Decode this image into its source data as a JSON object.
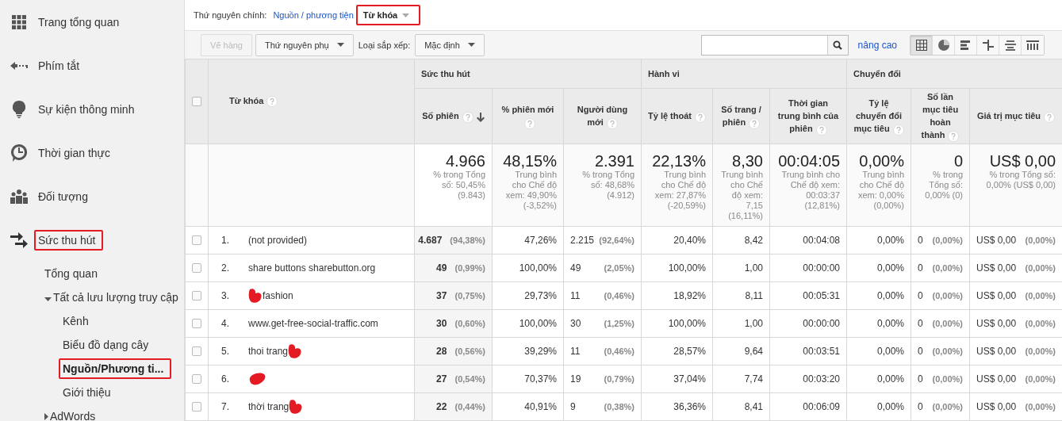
{
  "sidebar": {
    "items": [
      {
        "label": "Trang tổng quan",
        "selected": false
      },
      {
        "label": "Phím tắt",
        "selected": false
      },
      {
        "label": "Sự kiện thông minh",
        "selected": false
      },
      {
        "label": "Thời gian thực",
        "selected": false
      },
      {
        "label": "Đối tượng",
        "selected": false
      },
      {
        "label": "Sức thu hút",
        "selected": false,
        "annotated": true,
        "children": [
          {
            "label": "Tổng quan",
            "selected": false
          },
          {
            "label": "Tất cả lưu lượng truy cập",
            "expanded": true,
            "selected": false,
            "children": [
              {
                "label": "Kênh",
                "selected": false
              },
              {
                "label": "Biểu đồ dạng cây",
                "selected": false
              },
              {
                "label": "Nguồn/Phương ti...",
                "selected": true,
                "annotated": true
              },
              {
                "label": "Giới thiệu",
                "selected": false
              }
            ]
          },
          {
            "label": "AdWords",
            "expanded": false,
            "selected": false
          }
        ]
      }
    ]
  },
  "dimension_bar": {
    "label": "Thứ nguyên chính:",
    "options": [
      {
        "label": "Nguồn / phương tiện",
        "selected": false
      },
      {
        "label": "Từ khóa",
        "selected": true,
        "annotated": true
      }
    ]
  },
  "toolbar": {
    "plot_button": {
      "label": "Vẽ hàng",
      "disabled": true
    },
    "secondary_dimension": "Thứ nguyên phụ",
    "sort_label": "Loại sắp xếp:",
    "sort_value": "Mặc định",
    "advanced_link": "nâng cao",
    "views": [
      {
        "selected": true
      },
      {
        "selected": false
      },
      {
        "selected": false
      },
      {
        "selected": false
      },
      {
        "selected": false
      },
      {
        "selected": false
      }
    ]
  },
  "table": {
    "select_all_checked": false,
    "dimension_column": {
      "label": "Từ khóa",
      "help": true
    },
    "groups": [
      {
        "label": "Sức thu hút"
      },
      {
        "label": "Hành vi"
      },
      {
        "label": "Chuyển đổi"
      }
    ],
    "columns": [
      {
        "label": "Số phiên",
        "help": true,
        "sorted": true
      },
      {
        "label": "% phiên mới",
        "help": true,
        "sorted": false
      },
      {
        "label": "Người dùng mới",
        "help": true,
        "sorted": false
      },
      {
        "label": "Tỷ lệ thoát",
        "help": true,
        "sorted": false
      },
      {
        "label": "Số trang / phiên",
        "help": true,
        "sorted": false
      },
      {
        "label": "Thời gian trung bình của phiên",
        "help": true,
        "sorted": false
      },
      {
        "label": "Tỷ lệ chuyển đổi mục tiêu",
        "help": true,
        "sorted": false
      },
      {
        "label": "Số lần mục tiêu hoàn thành",
        "help": true,
        "sorted": false
      },
      {
        "label": "Giá trị mục tiêu",
        "help": true,
        "sorted": false
      }
    ],
    "totals": [
      {
        "value": "4.966",
        "note": "% trong Tổng số: 50,45% (9.843)"
      },
      {
        "value": "48,15%",
        "note": "Trung bình cho Chế độ xem: 49,90% (-3,52%)"
      },
      {
        "value": "2.391",
        "note": "% trong Tổng số: 48,68% (4.912)"
      },
      {
        "value": "22,13%",
        "note": "Trung bình cho Chế độ xem: 27,87% (-20,59%)"
      },
      {
        "value": "8,30",
        "note": "Trung bình cho Chế độ xem: 7,15 (16,11%)"
      },
      {
        "value": "00:04:05",
        "note": "Trung bình cho Chế độ xem: 00:03:37 (12,81%)"
      },
      {
        "value": "0,00%",
        "note": "Trung bình cho Chế độ xem: 0,00% (0,00%)"
      },
      {
        "value": "0",
        "note": "% trong Tổng số: 0,00% (0)"
      },
      {
        "value": "US$ 0,00",
        "note": "% trong Tổng số: 0,00% (US$ 0,00)"
      }
    ],
    "rows": [
      {
        "checked": false,
        "number": "1.",
        "keyword": [
          {
            "kind": "text",
            "text": "(not provided)"
          }
        ],
        "cells": [
          {
            "value": "4.687",
            "share": "(94,38%)"
          },
          {
            "value": "47,26%"
          },
          {
            "value": "2.215",
            "share": "(92,64%)"
          },
          {
            "value": "20,40%"
          },
          {
            "value": "8,42"
          },
          {
            "value": "00:04:08"
          },
          {
            "value": "0,00%"
          },
          {
            "value": "0",
            "share": "(0,00%)"
          },
          {
            "value": "US$ 0,00",
            "share": "(0,00%)"
          }
        ]
      },
      {
        "checked": false,
        "number": "2.",
        "keyword": [
          {
            "kind": "text",
            "text": "share buttons sharebutton.org"
          }
        ],
        "cells": [
          {
            "value": "49",
            "share": "(0,99%)"
          },
          {
            "value": "100,00%"
          },
          {
            "value": "49",
            "share": "(2,05%)"
          },
          {
            "value": "100,00%"
          },
          {
            "value": "1,00"
          },
          {
            "value": "00:00:00"
          },
          {
            "value": "0,00%"
          },
          {
            "value": "0",
            "share": "(0,00%)"
          },
          {
            "value": "US$ 0,00",
            "share": "(0,00%)"
          }
        ]
      },
      {
        "checked": false,
        "number": "3.",
        "keyword": [
          {
            "kind": "scribble"
          },
          {
            "kind": "text",
            "text": "fashion"
          }
        ],
        "cells": [
          {
            "value": "37",
            "share": "(0,75%)"
          },
          {
            "value": "29,73%"
          },
          {
            "value": "11",
            "share": "(0,46%)"
          },
          {
            "value": "18,92%"
          },
          {
            "value": "8,11"
          },
          {
            "value": "00:05:31"
          },
          {
            "value": "0,00%"
          },
          {
            "value": "0",
            "share": "(0,00%)"
          },
          {
            "value": "US$ 0,00",
            "share": "(0,00%)"
          }
        ]
      },
      {
        "checked": false,
        "number": "4.",
        "keyword": [
          {
            "kind": "text",
            "text": "www.get-free-social-traffic.com"
          }
        ],
        "cells": [
          {
            "value": "30",
            "share": "(0,60%)"
          },
          {
            "value": "100,00%"
          },
          {
            "value": "30",
            "share": "(1,25%)"
          },
          {
            "value": "100,00%"
          },
          {
            "value": "1,00"
          },
          {
            "value": "00:00:00"
          },
          {
            "value": "0,00%"
          },
          {
            "value": "0",
            "share": "(0,00%)"
          },
          {
            "value": "US$ 0,00",
            "share": "(0,00%)"
          }
        ]
      },
      {
        "checked": false,
        "number": "5.",
        "keyword": [
          {
            "kind": "text",
            "text": "thoi trang"
          },
          {
            "kind": "scribble"
          }
        ],
        "cells": [
          {
            "value": "28",
            "share": "(0,56%)"
          },
          {
            "value": "39,29%"
          },
          {
            "value": "11",
            "share": "(0,46%)"
          },
          {
            "value": "28,57%"
          },
          {
            "value": "9,64"
          },
          {
            "value": "00:03:51"
          },
          {
            "value": "0,00%"
          },
          {
            "value": "0",
            "share": "(0,00%)"
          },
          {
            "value": "US$ 0,00",
            "share": "(0,00%)"
          }
        ]
      },
      {
        "checked": false,
        "number": "6.",
        "keyword": [
          {
            "kind": "blot"
          }
        ],
        "cells": [
          {
            "value": "27",
            "share": "(0,54%)"
          },
          {
            "value": "70,37%"
          },
          {
            "value": "19",
            "share": "(0,79%)"
          },
          {
            "value": "37,04%"
          },
          {
            "value": "7,74"
          },
          {
            "value": "00:03:20"
          },
          {
            "value": "0,00%"
          },
          {
            "value": "0",
            "share": "(0,00%)"
          },
          {
            "value": "US$ 0,00",
            "share": "(0,00%)"
          }
        ]
      },
      {
        "checked": false,
        "number": "7.",
        "keyword": [
          {
            "kind": "text",
            "text": "thời trang"
          },
          {
            "kind": "scribble"
          }
        ],
        "cells": [
          {
            "value": "22",
            "share": "(0,44%)"
          },
          {
            "value": "40,91%"
          },
          {
            "value": "9",
            "share": "(0,38%)"
          },
          {
            "value": "36,36%"
          },
          {
            "value": "8,41"
          },
          {
            "value": "00:06:09"
          },
          {
            "value": "0,00%"
          },
          {
            "value": "0",
            "share": "(0,00%)"
          },
          {
            "value": "US$ 0,00",
            "share": "(0,00%)"
          }
        ]
      }
    ]
  }
}
